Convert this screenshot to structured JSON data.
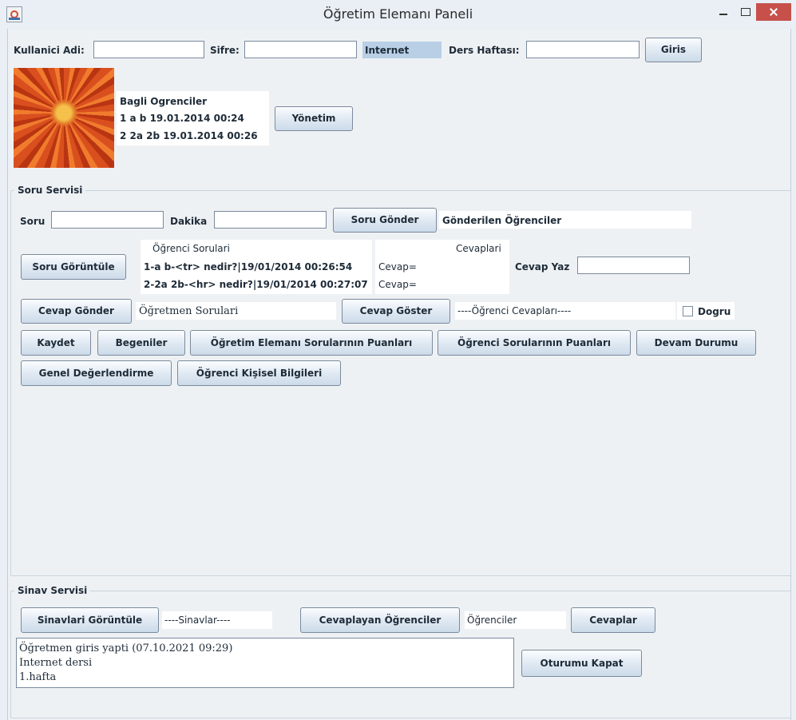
{
  "window": {
    "title": "Öğretim Elemanı Paneli"
  },
  "login": {
    "username_label": "Kullanici Adi:",
    "password_label": "Sifre:",
    "course_label": "Internet",
    "week_label": "Ders Haftası:",
    "login_button": "Giris"
  },
  "connected": {
    "title": "Bagli Ogrenciler",
    "items": [
      "1 a b 19.01.2014 00:24",
      "2 2a 2b 19.01.2014 00:26"
    ],
    "manage_button": "Yönetim"
  },
  "question_service": {
    "legend": "Soru Servisi",
    "question_label": "Soru",
    "minute_label": "Dakika",
    "send_button": "Soru Gönder",
    "sent_students": "Gönderilen Öğrenciler",
    "view_button": "Soru Görüntüle",
    "student_questions_title": "Öğrenci Sorulari",
    "student_questions": [
      "1-a b-<tr> nedir?|19/01/2014 00:26:54",
      "2-2a 2b-<hr> nedir?|19/01/2014 00:27:07"
    ],
    "answers_title": "Cevaplari",
    "answers": [
      "Cevap=",
      "Cevap="
    ],
    "write_answer_label": "Cevap Yaz",
    "send_answer_button": "Cevap Gönder",
    "teacher_questions": "Öğretmen Sorulari",
    "show_answer_button": "Cevap Göster",
    "student_answers": "----Öğrenci Cevapları----",
    "correct_label": "Dogru",
    "save_button": "Kaydet",
    "likes_button": "Begeniler",
    "instructor_scores_button": "Öğretim Elemanı Sorularının Puanları",
    "student_scores_button": "Öğrenci Sorularının Puanları",
    "attendance_button": "Devam Durumu",
    "general_eval_button": "Genel Değerlendirme",
    "personal_info_button": "Öğrenci Kişisel Bilgileri"
  },
  "exam_service": {
    "legend": "Sinav Servisi",
    "view_exams_button": "Sinavlari Görüntüle",
    "exams_text": "----Sinavlar----",
    "answered_students_button": "Cevaplayan Öğrenciler",
    "students_text": "Öğrenciler",
    "answers_button": "Cevaplar",
    "log": [
      "Öğretmen giris yapti (07.10.2021 09:29)",
      "Internet dersi",
      "1.hafta"
    ],
    "logout_button": "Oturumu Kapat"
  }
}
